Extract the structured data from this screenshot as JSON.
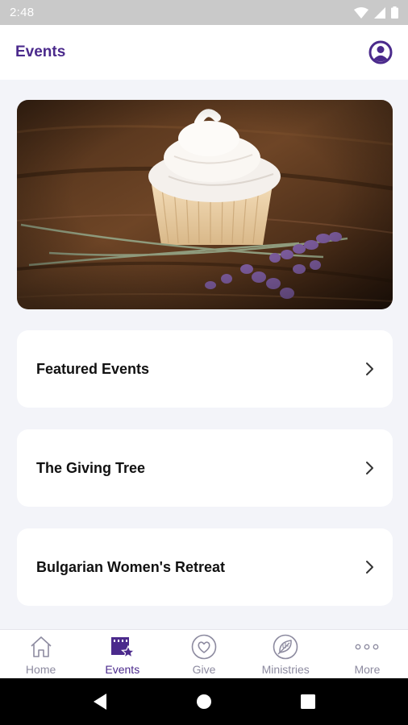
{
  "status_bar": {
    "time": "2:48"
  },
  "header": {
    "title": "Events"
  },
  "colors": {
    "accent": "#4b2a8c",
    "inactive": "#8d8ba0",
    "background": "#f3f4f9"
  },
  "hero": {
    "description": "cupcake-with-lavender-photo"
  },
  "event_list": [
    {
      "label": "Featured Events"
    },
    {
      "label": "The Giving Tree"
    },
    {
      "label": "Bulgarian Women's Retreat"
    }
  ],
  "bottom_nav": [
    {
      "label": "Home",
      "icon": "home-icon",
      "active": false
    },
    {
      "label": "Events",
      "icon": "calendar-star-icon",
      "active": true
    },
    {
      "label": "Give",
      "icon": "heart-circle-icon",
      "active": false
    },
    {
      "label": "Ministries",
      "icon": "leaf-icon",
      "active": false
    },
    {
      "label": "More",
      "icon": "more-dots-icon",
      "active": false
    }
  ]
}
